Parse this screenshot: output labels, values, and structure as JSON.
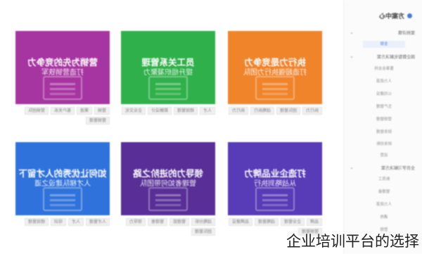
{
  "sidebar": {
    "title": "方案中心",
    "groups": [
      {
        "label": "案例详情",
        "items": [
          {
            "label": "全部",
            "active": true
          }
        ]
      },
      {
        "label": "国企数智化解决方案",
        "items": [
          {
            "label": "董事会支持"
          },
          {
            "label": "人力资源"
          },
          {
            "label": "公司建设"
          },
          {
            "label": "生产管理"
          },
          {
            "label": "营销管理"
          },
          {
            "label": "财务管理"
          },
          {
            "label": "研发创新"
          },
          {
            "label": "运营"
          }
        ]
      },
      {
        "label": "全员学习解决方案",
        "items": [
          {
            "label": "新员工"
          },
          {
            "label": "管理者"
          },
          {
            "label": "人力资源"
          },
          {
            "label": "通用"
          },
          {
            "label": "营销"
          }
        ]
      }
    ]
  },
  "cards": [
    {
      "title": "执行力是竞争力",
      "subtitle": "打造超强执行力团队",
      "color": "#ef7a1a",
      "tags": [
        "执行力",
        "团队管理",
        "战略执行",
        "执行力"
      ]
    },
    {
      "title": "员工关系管理",
      "subtitle": "提升组织凝聚力",
      "color": "#1faa3c",
      "tags": [
        "人才",
        "绩效管理",
        "薪酬设计",
        "企业文化"
      ]
    },
    {
      "title": "营销为先的竞争力",
      "subtitle": "打造营销铁军",
      "color": "#a0249a",
      "tags": [
        "营销",
        "渠道",
        "客户关系",
        "营销团队",
        "营销管理"
      ]
    },
    {
      "title": "打造企业品牌力",
      "subtitle": "从战略到执行",
      "color": "#4a2bb0",
      "tags": [
        "品牌",
        "企业管理",
        "战略管理",
        "品牌建设",
        "营销管理"
      ]
    },
    {
      "title": "领导力的进阶之路",
      "subtitle": "管理者如何带团队",
      "color": "#4b1e8f",
      "tags": [
        "战略分析",
        "管理层",
        "管理者",
        "领导力",
        "团队管理"
      ]
    },
    {
      "title": "如何让优秀的人才留下",
      "subtitle": "人才梯队建设之道",
      "color": "#1f67d8",
      "tags": [
        "人才管理",
        "人才",
        "培训",
        "绩效管理"
      ]
    }
  ],
  "caption": "企业培训平台的选择"
}
